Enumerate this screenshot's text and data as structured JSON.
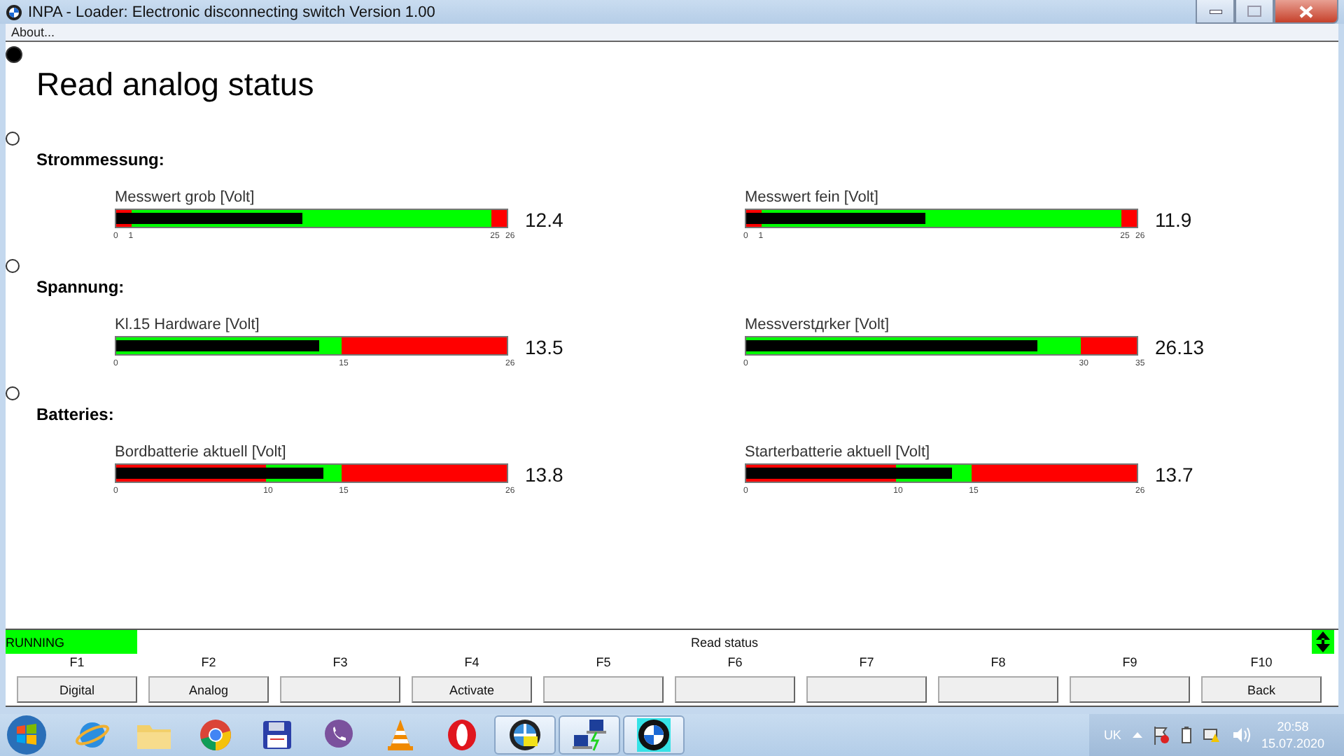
{
  "window": {
    "title": "INPA - Loader:  Electronic disconnecting switch Version 1.00"
  },
  "menu": [
    "About..."
  ],
  "radios": [
    {
      "selected": true
    },
    {
      "selected": false
    },
    {
      "selected": false
    },
    {
      "selected": false
    }
  ],
  "heading": "Read analog status",
  "sections": [
    {
      "title": "Strommessung:",
      "gauges": [
        {
          "label": "Messwert grob [Volt]",
          "reading": "12.4",
          "level": 0.477,
          "zones": [
            {
              "color": "#ff0000"
            },
            {
              "color": "#00ff00"
            },
            {
              "color": "#ff0000"
            }
          ],
          "ticks": [
            "0",
            "1",
            "25",
            "26"
          ]
        },
        {
          "label": "Messwert fein [Volt]",
          "reading": "11.9",
          "level": 0.458,
          "zones": [
            {
              "color": "#ff0000"
            },
            {
              "color": "#00ff00"
            },
            {
              "color": "#ff0000"
            }
          ],
          "ticks": [
            "0",
            "1",
            "25",
            "26"
          ]
        }
      ]
    },
    {
      "title": "Spannung:",
      "gauges": [
        {
          "label": "Kl.15 Hardware [Volt]",
          "reading": "13.5",
          "level": 0.519,
          "zones": [
            {
              "color": "#00ff00"
            },
            {
              "color": "#ff0000"
            }
          ],
          "ticks": [
            "0",
            "15",
            "26"
          ]
        },
        {
          "label": "Messverstдrker [Volt]",
          "reading": "26.13",
          "level": 0.747,
          "zones": [
            {
              "color": "#00ff00"
            },
            {
              "color": "#ff0000"
            }
          ],
          "ticks": [
            "0",
            "30",
            "35"
          ]
        }
      ]
    },
    {
      "title": "Batteries:",
      "gauges": [
        {
          "label": "Bordbatterie aktuell [Volt]",
          "reading": "13.8",
          "level": 0.531,
          "zones": [
            {
              "color": "#ff0000"
            },
            {
              "color": "#00ff00"
            },
            {
              "color": "#ff0000"
            }
          ],
          "ticks": [
            "0",
            "10",
            "15",
            "26"
          ]
        },
        {
          "label": "Starterbatterie aktuell [Volt]",
          "reading": "13.7",
          "level": 0.527,
          "zones": [
            {
              "color": "#ff0000"
            },
            {
              "color": "#00ff00"
            },
            {
              "color": "#ff0000"
            }
          ],
          "ticks": [
            "0",
            "10",
            "15",
            "26"
          ]
        }
      ]
    }
  ],
  "status_bar": {
    "state": "RUNNING",
    "message": "Read status"
  },
  "function_keys": [
    {
      "key": "F1",
      "label": "Digital"
    },
    {
      "key": "F2",
      "label": "Analog"
    },
    {
      "key": "F3"
    },
    {
      "key": "F4",
      "label": "Activate"
    },
    {
      "key": "F5"
    },
    {
      "key": "F6"
    },
    {
      "key": "F7"
    },
    {
      "key": "F8"
    },
    {
      "key": "F9"
    },
    {
      "key": "F10",
      "label": "Back"
    }
  ],
  "taskbar": {
    "apps": [
      {
        "kind": "browser",
        "running": false
      },
      {
        "kind": "folder",
        "running": false
      },
      {
        "kind": "chrome",
        "running": false
      },
      {
        "kind": "floppy",
        "running": false
      },
      {
        "kind": "phone",
        "running": false
      },
      {
        "kind": "cone",
        "running": false
      },
      {
        "kind": "ring",
        "running": false
      },
      {
        "kind": "wheel",
        "running": true
      },
      {
        "kind": "network",
        "running": true
      },
      {
        "kind": "roundel",
        "running": true
      }
    ],
    "language": "UK",
    "time": "20:58",
    "date": "15.07.2020"
  }
}
